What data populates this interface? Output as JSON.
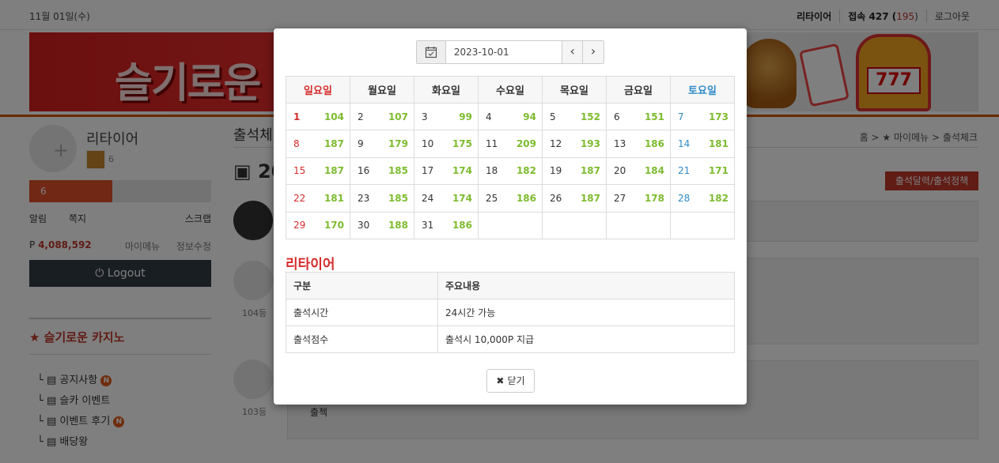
{
  "topbar": {
    "date": "11월 01일(수)",
    "username": "리타이어",
    "visit_prefix": "접속 427 (",
    "visit_count": "195",
    "visit_suffix": ")",
    "logout": "로그아웃"
  },
  "banner": {
    "logo_text": "슬기로운",
    "slot_text": "777"
  },
  "sidebar": {
    "name": "리타이어",
    "level": "6",
    "exp_label": "6",
    "links": [
      "알림",
      "쪽지",
      "스크랩"
    ],
    "point_label": "P",
    "point_value": "4,088,592",
    "my_menu": "마이메뉴",
    "edit_info": "정보수정",
    "logout_button": "Logout",
    "section_title": "슬기로운 카지노",
    "menu": [
      {
        "label": "공지사항",
        "badge": "N"
      },
      {
        "label": "슬카 이벤트",
        "badge": ""
      },
      {
        "label": "이벤트 후기",
        "badge": "N"
      },
      {
        "label": "배당왕",
        "badge": ""
      }
    ]
  },
  "main": {
    "title": "출석체",
    "breadcrumb": "홈 > ★ 마이메뉴 > 출석체크",
    "calendar_heading": "20",
    "policy_button": "출석달력/출석정책",
    "ranks": [
      "104등",
      "103등"
    ],
    "check_text": "출첵"
  },
  "modal": {
    "date_value": "2023-10-01",
    "prev_label": "‹",
    "next_label": "›",
    "weekdays": [
      "일요일",
      "월요일",
      "화요일",
      "수요일",
      "목요일",
      "금요일",
      "토요일"
    ],
    "weeks": [
      [
        [
          "1",
          "104"
        ],
        [
          "2",
          "107"
        ],
        [
          "3",
          "99"
        ],
        [
          "4",
          "94"
        ],
        [
          "5",
          "152"
        ],
        [
          "6",
          "151"
        ],
        [
          "7",
          "173"
        ]
      ],
      [
        [
          "8",
          "187"
        ],
        [
          "9",
          "179"
        ],
        [
          "10",
          "175"
        ],
        [
          "11",
          "209"
        ],
        [
          "12",
          "193"
        ],
        [
          "13",
          "186"
        ],
        [
          "14",
          "181"
        ]
      ],
      [
        [
          "15",
          "187"
        ],
        [
          "16",
          "185"
        ],
        [
          "17",
          "174"
        ],
        [
          "18",
          "182"
        ],
        [
          "19",
          "187"
        ],
        [
          "20",
          "184"
        ],
        [
          "21",
          "171"
        ]
      ],
      [
        [
          "22",
          "181"
        ],
        [
          "23",
          "185"
        ],
        [
          "24",
          "174"
        ],
        [
          "25",
          "186"
        ],
        [
          "26",
          "187"
        ],
        [
          "27",
          "178"
        ],
        [
          "28",
          "182"
        ]
      ],
      [
        [
          "29",
          "170"
        ],
        [
          "30",
          "188"
        ],
        [
          "31",
          "186"
        ],
        [
          "",
          ""
        ],
        [
          "",
          ""
        ],
        [
          "",
          ""
        ],
        [
          "",
          ""
        ]
      ]
    ],
    "info_title": "리타이어",
    "info_headers": [
      "구분",
      "주요내용"
    ],
    "info_rows": [
      [
        "출석시간",
        "24시간 가능"
      ],
      [
        "출석점수",
        "출석시 10,000P 지급"
      ]
    ],
    "close_label": "닫기",
    "close_symbol": "✖"
  },
  "colors": {
    "sunday": "#d62b2b",
    "saturday": "#2e8bc9",
    "count": "#7dbb2f",
    "accent": "#c0392b"
  }
}
